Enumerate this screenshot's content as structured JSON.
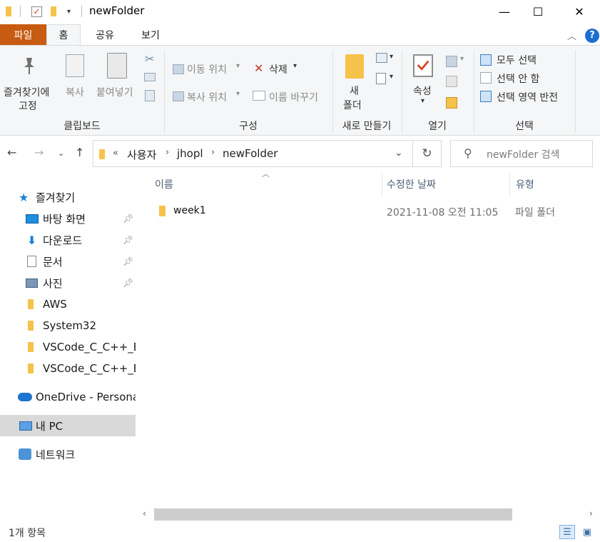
{
  "window": {
    "title": "newFolder",
    "minimize_glyph": "—",
    "maximize_glyph": "☐",
    "close_glyph": "✕"
  },
  "ribbon_tabs": {
    "file": "파일",
    "home": "홈",
    "share": "공유",
    "view": "보기"
  },
  "ribbon": {
    "clipboard": {
      "pin_label_1": "즐겨찾기에",
      "pin_label_2": "고정",
      "copy": "복사",
      "paste": "붙여넣기",
      "group": "클립보드"
    },
    "organize": {
      "move_to": "이동 위치",
      "copy_to": "복사 위치",
      "delete": "삭제",
      "rename": "이름 바꾸기",
      "group": "구성"
    },
    "new": {
      "new_folder_1": "새",
      "new_folder_2": "폴더",
      "group": "새로 만들기"
    },
    "open": {
      "properties": "속성",
      "group": "열기"
    },
    "select": {
      "select_all": "모두 선택",
      "select_none": "선택 안 함",
      "invert": "선택 영역 반전",
      "group": "선택"
    }
  },
  "address": {
    "overflow": "«",
    "crumbs": [
      "사용자",
      "jhopl",
      "newFolder"
    ],
    "search_placeholder": "newFolder 검색"
  },
  "nav": {
    "quick_access": "즐겨찾기",
    "items": [
      {
        "label": "바탕 화면",
        "icon": "desktop-icon",
        "pinned": true
      },
      {
        "label": "다운로드",
        "icon": "download-icon",
        "pinned": true
      },
      {
        "label": "문서",
        "icon": "document-icon",
        "pinned": true
      },
      {
        "label": "사진",
        "icon": "pictures-icon",
        "pinned": true
      },
      {
        "label": "AWS",
        "icon": "folder-icon",
        "pinned": false
      },
      {
        "label": "System32",
        "icon": "folder-icon",
        "pinned": false
      },
      {
        "label": "VSCode_C_C++_EN",
        "icon": "folder-icon",
        "pinned": false
      },
      {
        "label": "VSCode_C_C++_EN",
        "icon": "folder-icon",
        "pinned": false
      }
    ],
    "onedrive": "OneDrive - Personal",
    "this_pc": "내 PC",
    "network": "네트워크"
  },
  "columns": {
    "name": "이름",
    "modified": "수정한 날짜",
    "type": "유형"
  },
  "files": [
    {
      "name": "week1",
      "modified": "2021-11-08 오전 11:05",
      "type": "파일 폴더"
    }
  ],
  "status": {
    "item_count": "1개 항목"
  }
}
